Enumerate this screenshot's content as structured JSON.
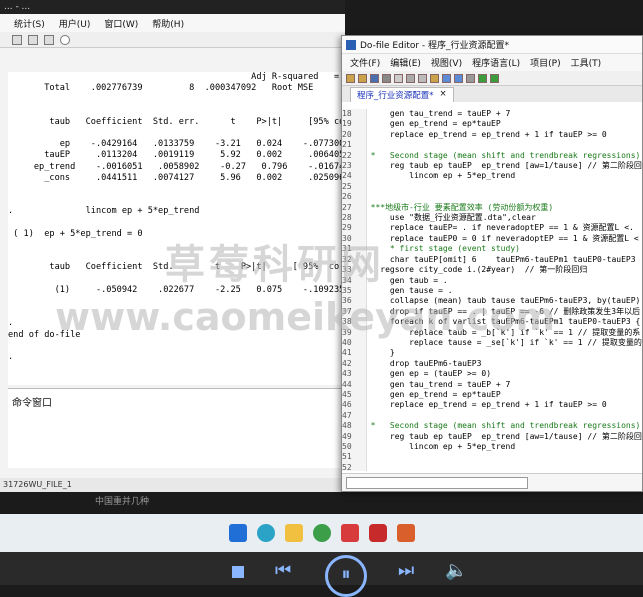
{
  "stata": {
    "title_fragment": "... - ...",
    "menu": [
      "统计(S)",
      "用户(U)",
      "窗口(W)",
      "帮助(H)"
    ],
    "results_text": "                                               Adj R-squared   =\n       Total    .002776739         8  .000347092   Root MSE        =\n\n\n        taub   Coefficient  Std. err.      t    P>|t|     [95% conf. in\n\n          ep    -.0429164   .0133759    -3.21   0.024    -.0773001    -\n       tauEP     .0113204   .0019119     5.92   0.002     .0064058\n     ep_trend    -.0016051   .0058902    -0.27   0.796    -.0167465\n       _cons     .0441511   .0074127     5.96   0.002     .0250961\n\n\n.              lincom ep + 5*ep_trend\n\n ( 1)  ep + 5*ep_trend = 0\n\n\n        taub   Coefficient  Std.        t    P>|t|     [ 95%  co   i\n\n         (1)     -.050942    .022677    -2.25   0.075    -.109235\n\n\n.\nend of do-file\n\n.",
    "command_window_label": "命令窗口",
    "status_text": "31726WU_FILE_1",
    "bottom_text": "中国重并几种"
  },
  "dofile": {
    "title": "Do-file Editor - 程序_行业资源配置*",
    "menu": [
      "文件(F)",
      "编辑(E)",
      "视图(V)",
      "程序语言(L)",
      "项目(P)",
      "工具(T)"
    ],
    "tab_label": "程序_行业资源配置*",
    "tab_close": "×",
    "line_numbers": [
      18,
      19,
      20,
      21,
      22,
      23,
      24,
      25,
      26,
      27,
      28,
      29,
      30,
      31,
      32,
      33,
      34,
      35,
      36,
      37,
      38,
      39,
      40,
      41,
      42,
      43,
      44,
      45,
      46,
      47,
      48,
      49,
      50,
      51,
      52,
      53
    ],
    "code_lines": [
      "    gen tau_trend = tauEP + 7",
      "    gen ep_trend = ep*tauEP",
      "    replace ep_trend = ep_trend + 1 if tauEP >= 0",
      "",
      "*   Second stage (mean shift and trendbreak regressions)",
      "    reg taub ep tauEP  ep_trend [aw=1/tause] // 第二阶段回",
      "        lincom ep + 5*ep_trend",
      "",
      "",
      "***地级市-行业 要素配置效率 (劳动份额为权重)",
      "    use \"数据_行业资源配置.dta\",clear",
      "    replace tauEP= . if neveradoptEP == 1 & 资源配置L <.",
      "    replace tauEP0 = 0 if neveradoptEP == 1 & 资源配置L <",
      "    * first stage (event study)",
      "    char tauEP[omit] 6    tauEPm6-tauEPm1 tauEP0-tauEP3  lo",
      "  regsore city_code i.(2#year)  // 第一阶段回归",
      "    gen taub = .",
      "    gen tause = .",
      "    collapse (mean) taub tause tauEPm6-tauEP3, by(tauEP)",
      "    drop if tauEP == . | tauEP == -6 // 删除政策发生3年以后",
      "    foreach k of varlist tauEPm6-tauEPm1 tauEP0-tauEP3 {",
      "        replace taub = _b[`k'] if `k' == 1 // 提取变量的系",
      "        replace tause = _se[`k'] if `k' == 1 // 提取变量的",
      "    }",
      "    drop tauEPm6-tauEP3",
      "    gen ep = (tauEP >= 0)",
      "    gen tau_trend = tauEP + 7",
      "    gen ep_trend = ep*tauEP",
      "    replace ep_trend = ep_trend + 1 if tauEP >= 0",
      "",
      "*   Second stage (mean shift and trendbreak regressions)",
      "    reg taub ep tauEP  ep_trend [aw=1/tause] // 第二阶段回",
      "        lincom ep + 5*ep_trend",
      "",
      "",
      ""
    ]
  },
  "watermark": {
    "line1": "草莓科研网",
    "line2": "www.caomeikeyan.com"
  },
  "colors": {
    "comment": "#1a7a1a",
    "keyword": "#1a31b8",
    "taskbar": "#e9eef3",
    "player_accent": "#8ab6ff"
  },
  "taskbar_icons": [
    "windows-icon",
    "edge-icon",
    "folder-icon",
    "chrome-icon",
    "wps-icon",
    "red-app-icon",
    "powerpoint-icon"
  ],
  "player_icons": [
    "stop-icon",
    "prev-icon",
    "pause-icon",
    "next-icon",
    "volume-icon"
  ]
}
